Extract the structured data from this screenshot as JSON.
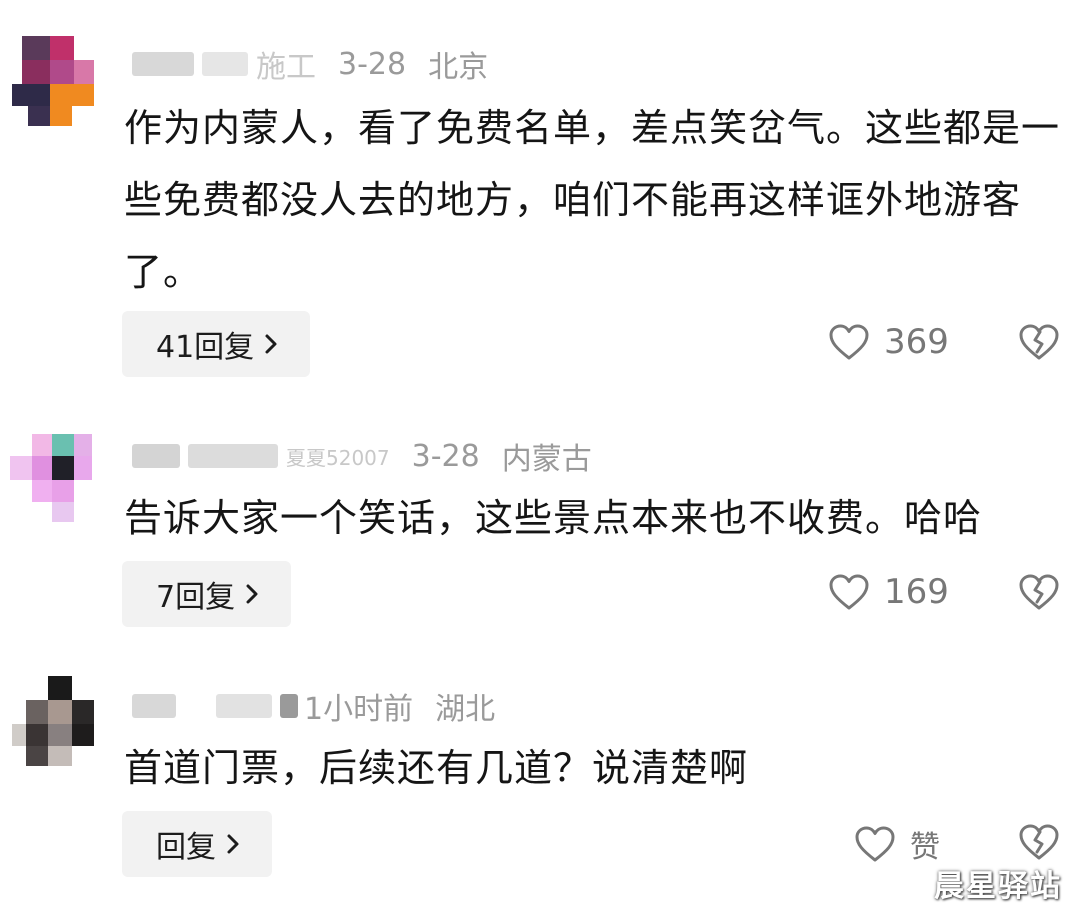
{
  "comments": [
    {
      "username_tail": "施工",
      "time": "3-28",
      "location": "北京",
      "text": "作为内蒙人，看了免费名单，差点笑岔气。这些都是一些免费都没人去的地方，咱们不能再这样诓外地游客了。",
      "reply_label": "41回复",
      "likes": "369"
    },
    {
      "username_tail": "夏夏52007",
      "time": "3-28",
      "location": "内蒙古",
      "text": "告诉大家一个笑话，这些景点本来也不收费。哈哈",
      "reply_label": "7回复",
      "likes": "169"
    },
    {
      "username_tail": "",
      "time": "1小时前",
      "location": "湖北",
      "text": "首道门票，后续还有几道？说清楚啊",
      "reply_label": "回复",
      "likes": "赞"
    }
  ],
  "icons": {
    "like": "heart-outline-icon",
    "dislike": "broken-heart-icon",
    "chevron": "chevron-right-icon"
  },
  "colors": {
    "text": "#151515",
    "meta": "#9a9a9a",
    "button_bg": "#f2f2f2",
    "icon": "#777777"
  },
  "watermark": "晨星驿站"
}
